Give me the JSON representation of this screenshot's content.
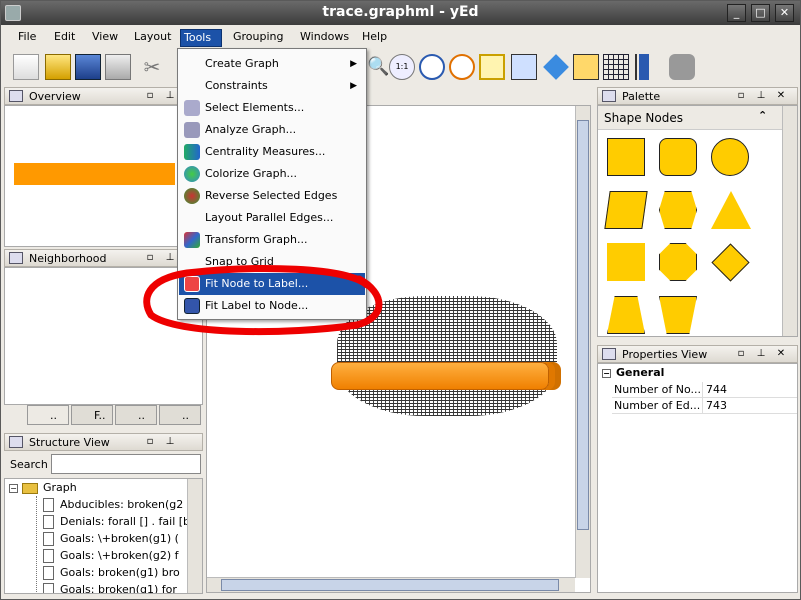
{
  "window": {
    "title": "trace.graphml - yEd",
    "controls": [
      "_",
      "□",
      "✕"
    ]
  },
  "menubar": {
    "items": [
      "File",
      "Edit",
      "View",
      "Layout",
      "Tools",
      "Grouping",
      "Windows",
      "Help"
    ],
    "active": "Tools"
  },
  "tools_menu": {
    "items": [
      {
        "label": "Create Graph",
        "submenu": true,
        "icon": "none"
      },
      {
        "label": "Constraints",
        "submenu": true,
        "icon": "none"
      },
      {
        "label": "Select Elements...",
        "icon": "select-elements-icon"
      },
      {
        "label": "Analyze Graph...",
        "icon": "analyze-graph-icon"
      },
      {
        "label": "Centrality Measures...",
        "icon": "centrality-icon"
      },
      {
        "label": "Colorize Graph...",
        "icon": "colorize-icon"
      },
      {
        "label": "Reverse Selected Edges",
        "icon": "reverse-edges-icon"
      },
      {
        "label": "Layout Parallel Edges...",
        "icon": "none"
      },
      {
        "label": "Transform Graph...",
        "icon": "transform-graph-icon"
      },
      {
        "label": "Snap to Grid",
        "icon": "none"
      },
      {
        "label": "Fit Node to Label...",
        "icon": "fit-node-icon",
        "highlighted": true
      },
      {
        "label": "Fit Label to Node...",
        "icon": "fit-label-icon"
      }
    ]
  },
  "panels": {
    "overview": {
      "title": "Overview"
    },
    "neighborhood": {
      "title": "Neighborhood",
      "tabs": [
        "..",
        "F..",
        "..",
        ".."
      ]
    },
    "structure": {
      "title": "Structure View",
      "search_label": "Search",
      "search_value": ""
    },
    "palette": {
      "title": "Palette",
      "section": "Shape Nodes"
    },
    "properties": {
      "title": "Properties View",
      "section": "General",
      "rows": [
        {
          "name": "Number of No...",
          "value": "744"
        },
        {
          "name": "Number of Ed...",
          "value": "743"
        }
      ]
    }
  },
  "tree": {
    "root": "Graph",
    "children": [
      "Abducibles:  broken(g2",
      "Denials:  forall [] . fail [b",
      "Goals:  \\+broken(g1)  (",
      "Goals:  \\+broken(g2)  f",
      "Goals:  broken(g1)  bro",
      "Goals:  broken(g1)  for"
    ]
  },
  "colors": {
    "accent": "#1c52a8",
    "node_fill": "#ffcc00",
    "overview_bar": "#ff9900",
    "annotation": "#ee0000"
  }
}
